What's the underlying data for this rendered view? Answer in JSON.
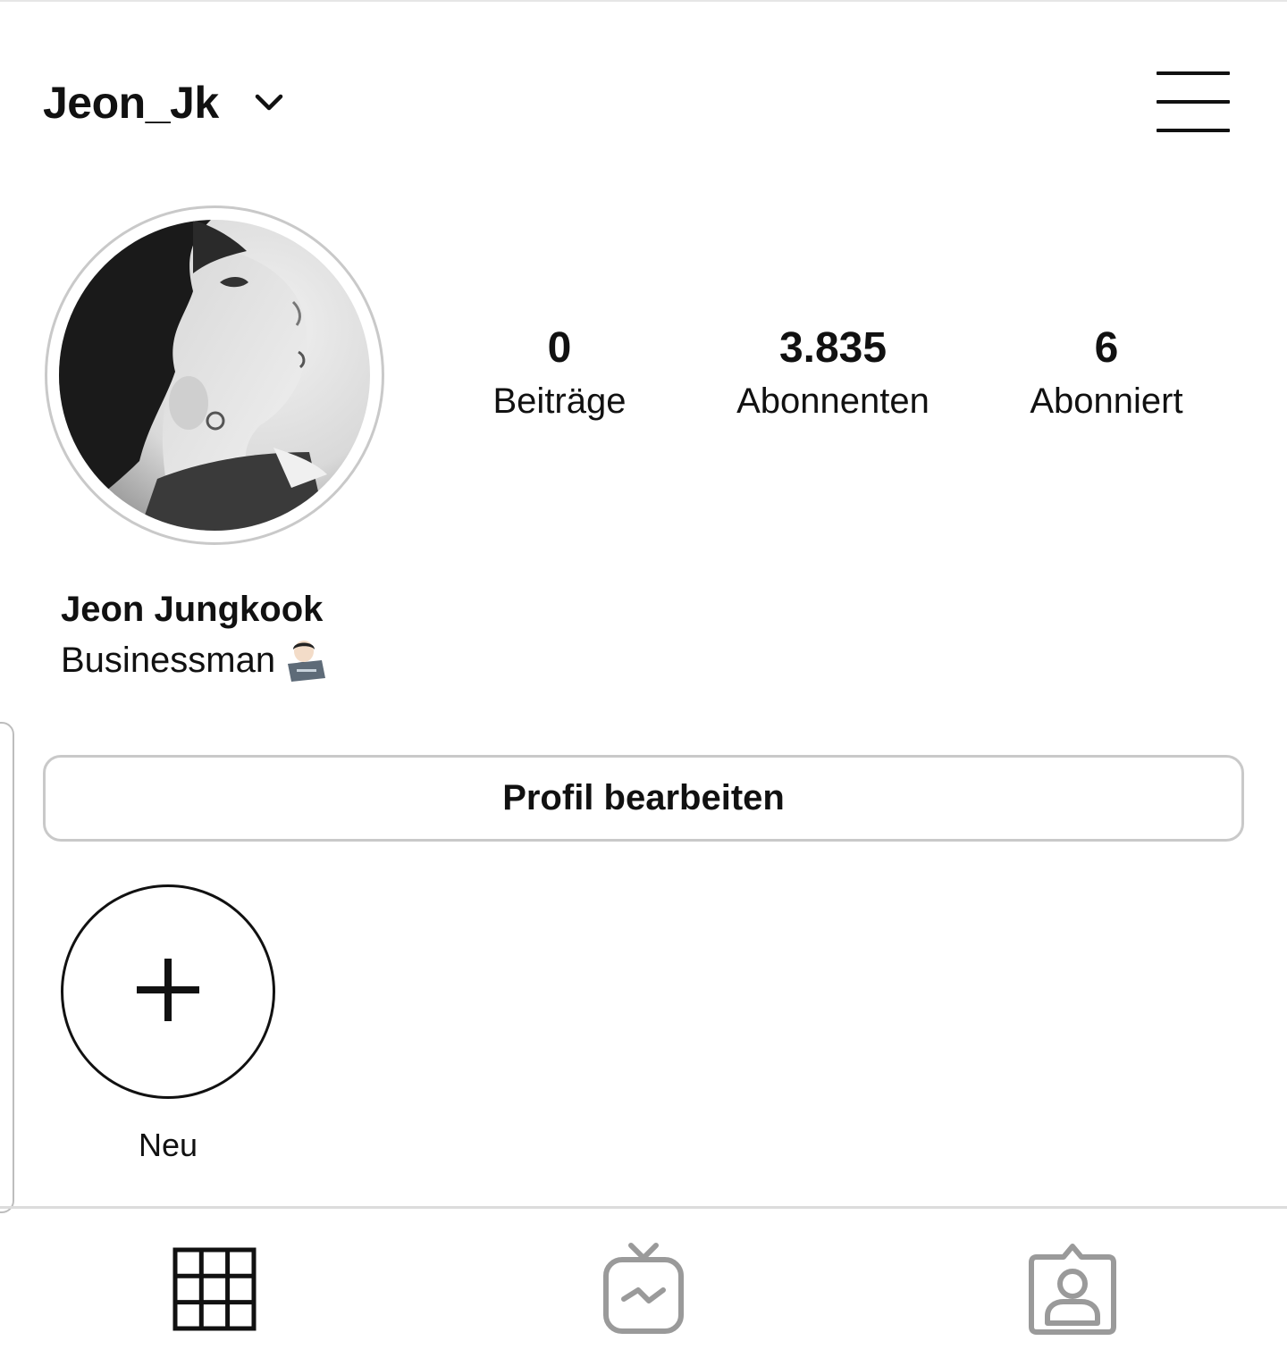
{
  "header": {
    "username": "Jeon_Jk",
    "account_switch_icon": "chevron-down-icon",
    "menu_icon": "hamburger-menu-icon"
  },
  "profile": {
    "avatar_alt": "profile-photo",
    "stats": [
      {
        "value": "0",
        "label": "Beiträge"
      },
      {
        "value": "3.835",
        "label": "Abonnenten"
      },
      {
        "value": "6",
        "label": "Abonniert"
      }
    ],
    "full_name": "Jeon Jungkook",
    "bio": "Businessman",
    "bio_emoji": "technologist-emoji"
  },
  "actions": {
    "edit_profile_label": "Profil bearbeiten"
  },
  "highlights": {
    "new_label": "Neu",
    "new_icon": "plus-icon"
  },
  "tabs": [
    {
      "name": "grid",
      "icon": "grid-icon",
      "active": true
    },
    {
      "name": "igtv",
      "icon": "igtv-icon",
      "active": false
    },
    {
      "name": "tagged",
      "icon": "tagged-icon",
      "active": false
    }
  ],
  "colors": {
    "text": "#111111",
    "border": "#c9c9c9",
    "inactive_icon": "#9a9a9a"
  }
}
